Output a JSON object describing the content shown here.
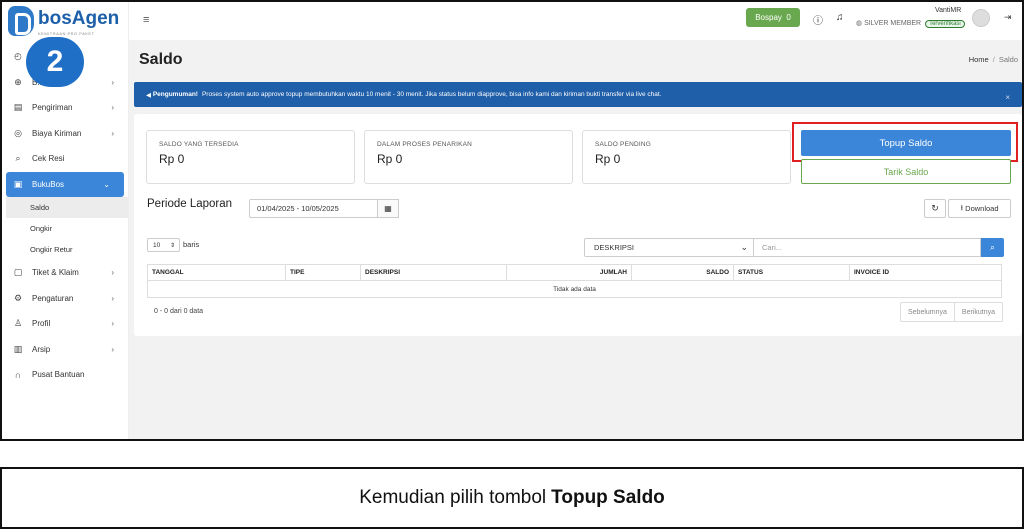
{
  "brand": {
    "name": "bosAgen",
    "tagline": "KEMITRAAN PRO PAKET"
  },
  "step_number": "2",
  "sidebar": {
    "items": [
      {
        "label": "",
        "icon": "dashboard-icon",
        "chevron": false
      },
      {
        "label": "B...",
        "icon": "plus-circle-icon",
        "chevron": true
      },
      {
        "label": "Pengiriman",
        "icon": "box-icon",
        "chevron": true
      },
      {
        "label": "Biaya Kiriman",
        "icon": "tag-icon",
        "chevron": true
      },
      {
        "label": "Cek Resi",
        "icon": "search-icon",
        "chevron": false
      },
      {
        "label": "BukuBos",
        "icon": "wallet-icon",
        "chevron": true,
        "active": true
      }
    ],
    "subitems": [
      "Saldo",
      "Ongkir",
      "Ongkir Retur"
    ],
    "bottom_items": [
      {
        "label": "Tiket & Klaim",
        "icon": "ticket-icon",
        "chevron": true
      },
      {
        "label": "Pengaturan",
        "icon": "gear-icon",
        "chevron": true
      },
      {
        "label": "Profil",
        "icon": "user-icon",
        "chevron": true
      },
      {
        "label": "Arsip",
        "icon": "archive-icon",
        "chevron": true
      },
      {
        "label": "Pusat Bantuan",
        "icon": "headset-icon",
        "chevron": false
      }
    ]
  },
  "topbar": {
    "bospay_label": "Bospay",
    "bospay_value": "0",
    "user_name": "VantiMR",
    "member_level": "SILVER MEMBER",
    "verified_label": "Terverifikasi"
  },
  "page": {
    "title": "Saldo",
    "breadcrumb_home": "Home",
    "breadcrumb_sep": "/",
    "breadcrumb_current": "Saldo"
  },
  "announcement": {
    "label": "Pengumuman!",
    "text": "Proses system auto approve topup membutuhkan waktu 10 menit - 30 menit. Jika status belum diapprove, bisa info kami dan kiriman bukti transfer via live chat.",
    "close": "×"
  },
  "stats": [
    {
      "label": "SALDO YANG TERSEDIA",
      "value": "Rp 0"
    },
    {
      "label": "DALAM PROSES PENARIKAN",
      "value": "Rp 0"
    },
    {
      "label": "SALDO PENDING",
      "value": "Rp 0"
    }
  ],
  "actions": {
    "topup": "Topup Saldo",
    "tarik": "Tarik Saldo"
  },
  "report": {
    "periode_label": "Periode Laporan",
    "date_range": "01/04/2025 - 10/05/2025",
    "download_label": "Download"
  },
  "table_controls": {
    "per_page": "10",
    "per_page_suffix": "baris",
    "filter_selected": "DESKRIPSI",
    "search_placeholder": "Cari..."
  },
  "table": {
    "columns": [
      "TANGGAL",
      "TIPE",
      "DESKRIPSI",
      "JUMLAH",
      "SALDO",
      "STATUS",
      "INVOICE ID"
    ],
    "empty_text": "Tidak ada data"
  },
  "pagination": {
    "count_text": "0 - 0 dari 0 data",
    "prev": "Sebelumnya",
    "next": "Berikutnya"
  },
  "caption": {
    "text": "Kemudian pilih tombol",
    "bold": "Topup Saldo"
  },
  "colors": {
    "primary": "#3b86d8",
    "brand": "#1d5fa8",
    "success": "#6aa84f",
    "highlight": "#e02020",
    "announce": "#1f5ea8"
  }
}
